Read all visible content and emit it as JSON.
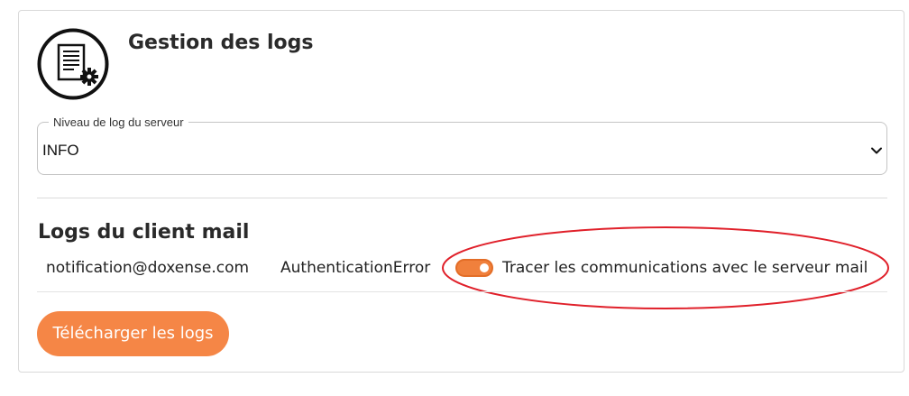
{
  "header": {
    "title": "Gestion des logs",
    "icon": "log-settings-icon"
  },
  "server_log": {
    "legend": "Niveau de log du serveur",
    "selected": "INFO"
  },
  "mail_logs": {
    "title": "Logs du client mail",
    "rows": [
      {
        "email": "notification@doxense.com",
        "status": "AuthenticationError",
        "trace_enabled": true,
        "trace_label": "Tracer les communications avec le serveur mail"
      }
    ]
  },
  "actions": {
    "download_label": "Télécharger les logs"
  },
  "colors": {
    "accent": "#f58646",
    "highlight": "#e0202a"
  }
}
